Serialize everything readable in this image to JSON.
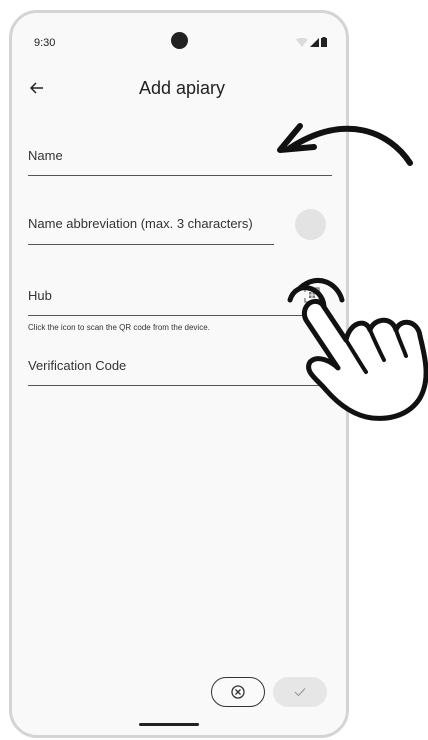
{
  "status_bar": {
    "time": "9:30"
  },
  "header": {
    "title": "Add apiary",
    "back_icon": "arrow-left-icon"
  },
  "form": {
    "name_label": "Name",
    "abbreviation_label": "Name abbreviation (max. 3 characters)",
    "hub_label": "Hub",
    "hub_helper": "Click the icon to scan the QR code from the device.",
    "verification_label": "Verification Code"
  },
  "actions": {
    "cancel_icon": "close-circle-icon",
    "confirm_icon": "check-icon"
  },
  "colors": {
    "background": "#f9f9f9",
    "frame": "#d4d4d4",
    "text": "#222222",
    "disabled_button": "#e6e6e6"
  }
}
